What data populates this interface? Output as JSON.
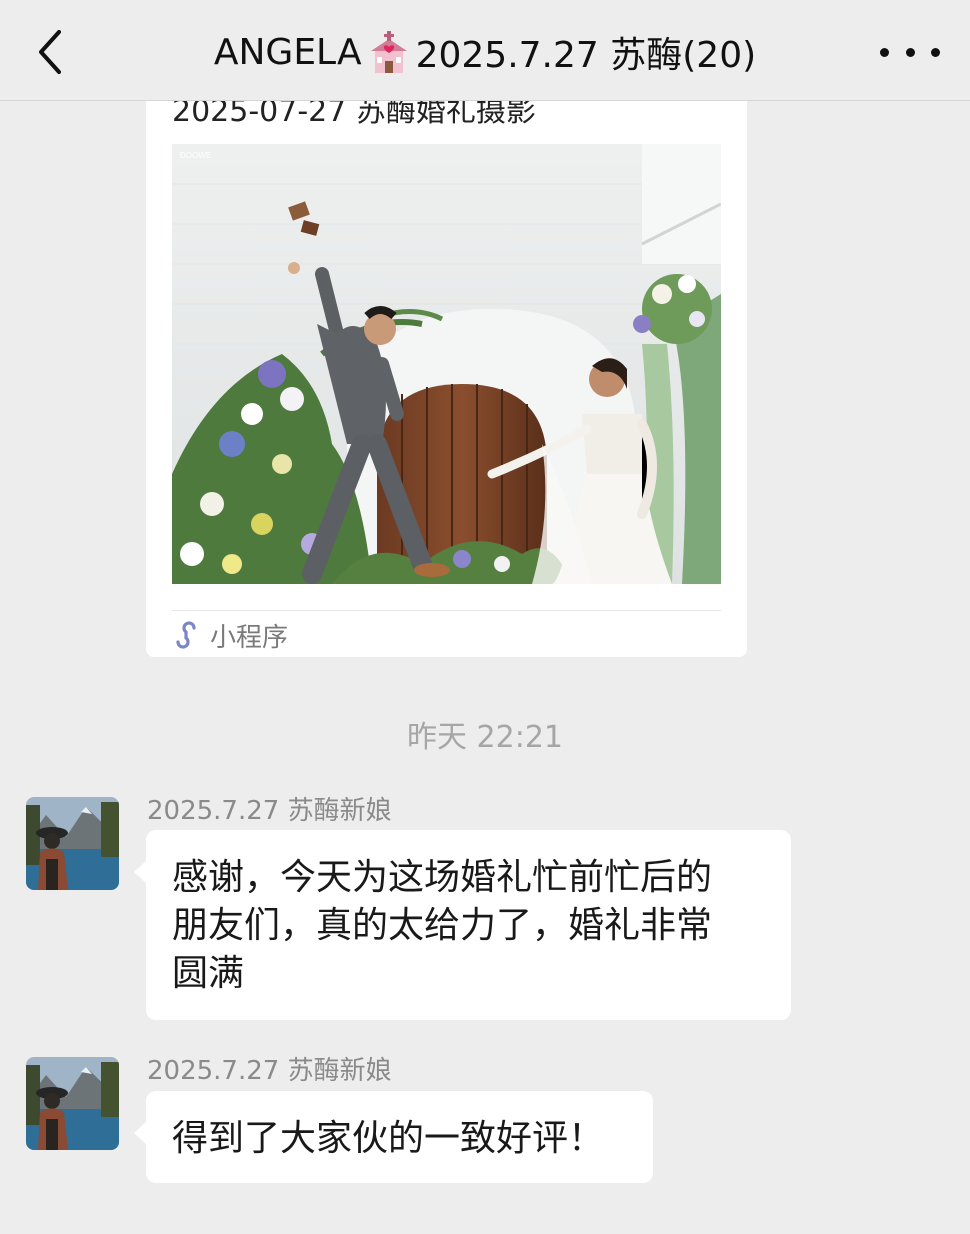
{
  "header": {
    "title_prefix": "ANGELA",
    "title_suffix": "2025.7.27 苏酶(20)",
    "title_emoji": "wedding-chapel-emoji"
  },
  "mini_program_card": {
    "title": "2025-07-27 苏酶婚礼摄影",
    "image": "wedding-ceremony-photo",
    "footer_label": "小程序",
    "footer_icon": "mini-program-icon"
  },
  "timestamp": "昨天 22:21",
  "messages": [
    {
      "sender": "2025.7.27 苏酶新娘",
      "text_lines": [
        "感谢，今天为这场婚礼忙前忙后的",
        "朋友们，真的太给力了，婚礼非常",
        "圆满"
      ],
      "avatar": "lake-mountain-avatar"
    },
    {
      "sender": "2025.7.27 苏酶新娘",
      "text_lines": [
        "得到了大家伙的一致好评！"
      ],
      "avatar": "lake-mountain-avatar"
    }
  ],
  "colors": {
    "background": "#ededed",
    "bubble": "#ffffff",
    "mini_program_icon": "#7b86c9"
  }
}
